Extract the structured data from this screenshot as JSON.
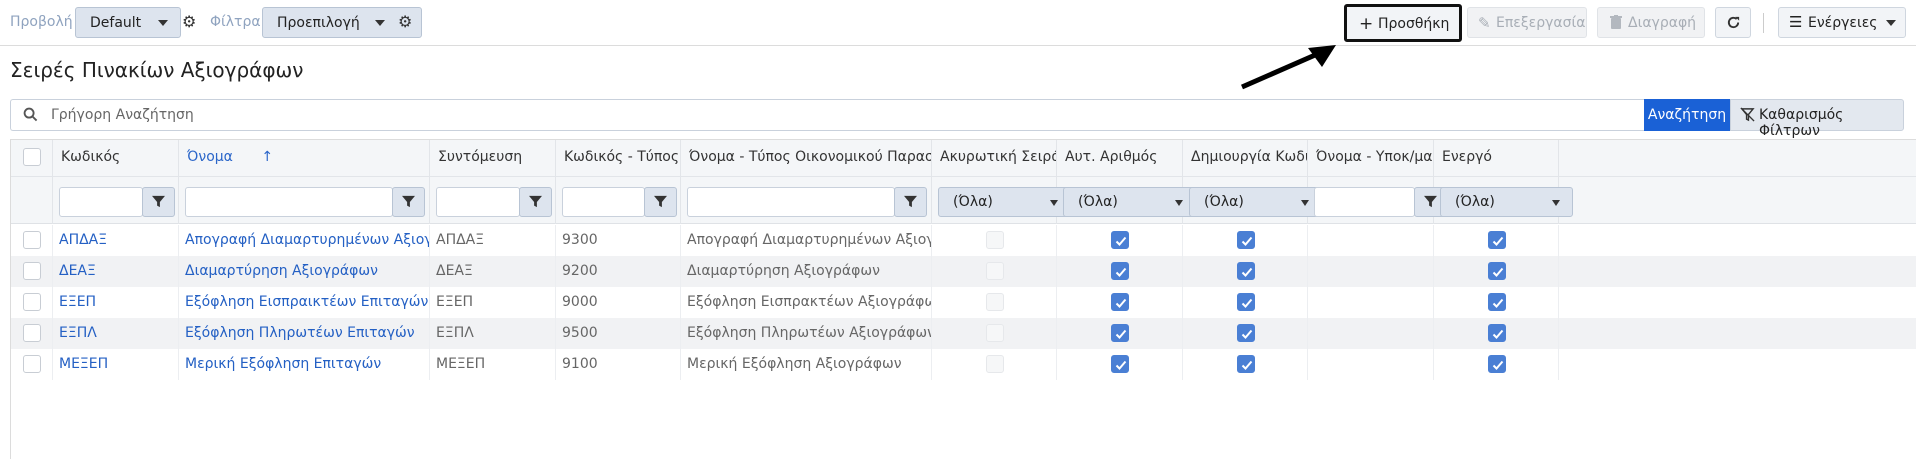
{
  "toolbar": {
    "view_label": "Προβολή",
    "view_value": "Default",
    "filter_label": "Φίλτρα",
    "filter_value": "Προεπιλογή",
    "add_label": "Προσθήκη",
    "edit_label": "Επεξεργασία",
    "delete_label": "Διαγραφή",
    "actions_label": "Ενέργειες"
  },
  "page_title": "Σειρές Πινακίων Αξιογράφων",
  "search": {
    "placeholder": "Γρήγορη Αναζήτηση",
    "search_button": "Αναζήτηση",
    "clear_button": "Καθαρισμός Φίλτρων"
  },
  "columns": [
    "Κωδικός",
    "Όνομα",
    "Συντόμευση",
    "Κωδικός - Τύπος Οι...",
    "Όνομα - Τύπος Οικονομικού Παραστατικού",
    "Ακυρωτική Σειρά",
    "Αυτ. Αριθμός",
    "Δημιουργία Κωδικού",
    "Όνομα - Υποκ/μα Ε...",
    "Ενεργό"
  ],
  "sort_indicator": "↑",
  "filter_all": "(Όλα)",
  "rows": [
    {
      "code": "ΑΠΔΑΞ",
      "name": "Απογραφή Διαμαρτυρημένων Αξιογράφων",
      "short": "ΑΠΔΑΞ",
      "doc_code": "9300",
      "doc_name": "Απογραφή Διαμαρτυρημένων Αξιογράφων",
      "cancel": false,
      "auto_num": true,
      "create_code": true,
      "active": true
    },
    {
      "code": "ΔΕΑΞ",
      "name": "Διαμαρτύρηση Αξιογράφων",
      "short": "ΔΕΑΞ",
      "doc_code": "9200",
      "doc_name": "Διαμαρτύρηση Αξιογράφων",
      "cancel": false,
      "auto_num": true,
      "create_code": true,
      "active": true
    },
    {
      "code": "ΕΞΕΠ",
      "name": "Εξόφληση Εισπραικτέων Επιταγών",
      "short": "ΕΞΕΠ",
      "doc_code": "9000",
      "doc_name": "Εξόφληση Εισπρακτέων Αξιογράφων",
      "cancel": false,
      "auto_num": true,
      "create_code": true,
      "active": true
    },
    {
      "code": "ΕΞΠΛ",
      "name": "Εξόφληση Πληρωτέων Επιταγών",
      "short": "ΕΞΠΛ",
      "doc_code": "9500",
      "doc_name": "Εξόφληση Πληρωτέων Αξιογράφων",
      "cancel": false,
      "auto_num": true,
      "create_code": true,
      "active": true
    },
    {
      "code": "ΜΕΞΕΠ",
      "name": "Μερική Εξόφληση Επιταγών",
      "short": "ΜΕΞΕΠ",
      "doc_code": "9100",
      "doc_name": "Μερική Εξόφληση Αξιογράφων",
      "cancel": false,
      "auto_num": true,
      "create_code": true,
      "active": true
    }
  ]
}
